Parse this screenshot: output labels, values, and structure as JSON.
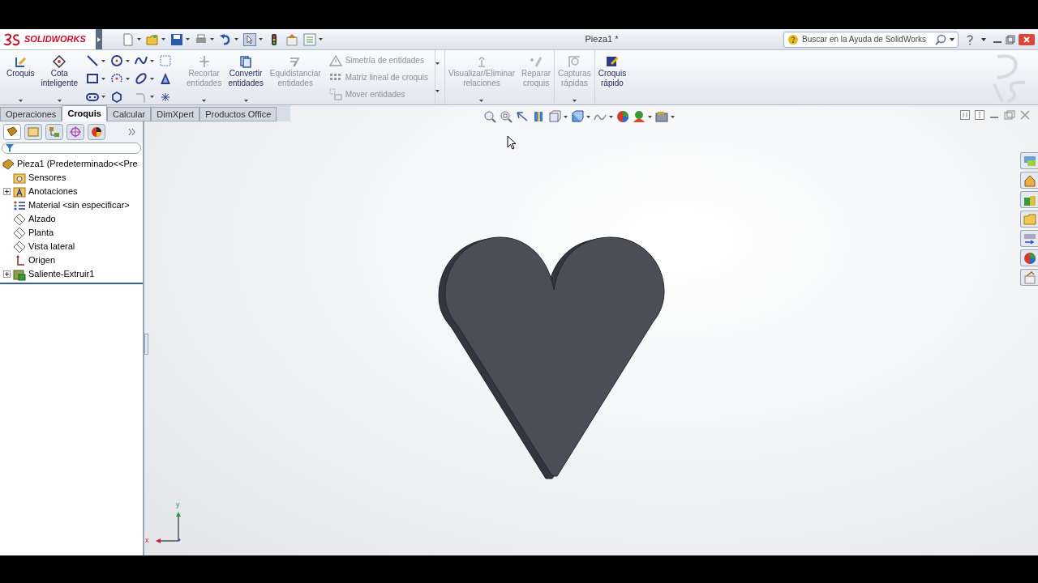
{
  "app": {
    "logo_text": "SOLIDWORKS"
  },
  "window": {
    "title": "Pieza1 *"
  },
  "search": {
    "placeholder": "Buscar en la Ayuda de SolidWorks"
  },
  "ribbon": {
    "items": [
      {
        "kind": "large",
        "label": "Croquis",
        "disabled": false,
        "dropdown": true
      },
      {
        "kind": "large",
        "label": "Cota\ninteligente",
        "disabled": false,
        "dropdown": true
      },
      {
        "kind": "tools"
      },
      {
        "kind": "large",
        "label": "Recortar\nentidades",
        "disabled": true,
        "dropdown": true
      },
      {
        "kind": "large",
        "label": "Convertir\nentidades",
        "disabled": false,
        "dropdown": true
      },
      {
        "kind": "large",
        "label": "Equidistanciar\nentidades",
        "disabled": true,
        "dropdown": false
      },
      {
        "kind": "small_group",
        "entries": [
          {
            "label": "Simetría de entidades",
            "disabled": true
          },
          {
            "label": "Matriz lineal de croquis",
            "disabled": true
          },
          {
            "label": "Mover entidades",
            "disabled": true
          }
        ]
      },
      {
        "kind": "large",
        "label": "Visualizar/Eliminar\nrelaciones",
        "disabled": true,
        "dropdown": true
      },
      {
        "kind": "large",
        "label": "Reparar\ncroquis",
        "disabled": true,
        "dropdown": false
      },
      {
        "kind": "large",
        "label": "Capturas\nrápidas",
        "disabled": true,
        "dropdown": true
      },
      {
        "kind": "large",
        "label": "Croquis\nrápido",
        "disabled": false,
        "dropdown": false
      }
    ]
  },
  "tabs": [
    {
      "label": "Operaciones",
      "selected": false
    },
    {
      "label": "Croquis",
      "selected": true
    },
    {
      "label": "Calcular",
      "selected": false
    },
    {
      "label": "DimXpert",
      "selected": false
    },
    {
      "label": "Productos Office",
      "selected": false
    }
  ],
  "feature_tree": {
    "root": {
      "kind": "part",
      "label": "Pieza1  (Predeterminado<<Pre",
      "children": [
        {
          "kind": "sensor",
          "label": "Sensores"
        },
        {
          "kind": "annotation",
          "label": "Anotaciones",
          "expanded": false
        },
        {
          "kind": "material",
          "label": "Material <sin especificar>"
        },
        {
          "kind": "plane",
          "label": "Alzado"
        },
        {
          "kind": "plane",
          "label": "Planta"
        },
        {
          "kind": "plane",
          "label": "Vista lateral"
        },
        {
          "kind": "origin",
          "label": "Origen"
        },
        {
          "kind": "extrude",
          "label": "Saliente-Extruir1",
          "expanded": false
        }
      ]
    }
  },
  "triad": {
    "x_label": "x",
    "y_label": "y"
  }
}
